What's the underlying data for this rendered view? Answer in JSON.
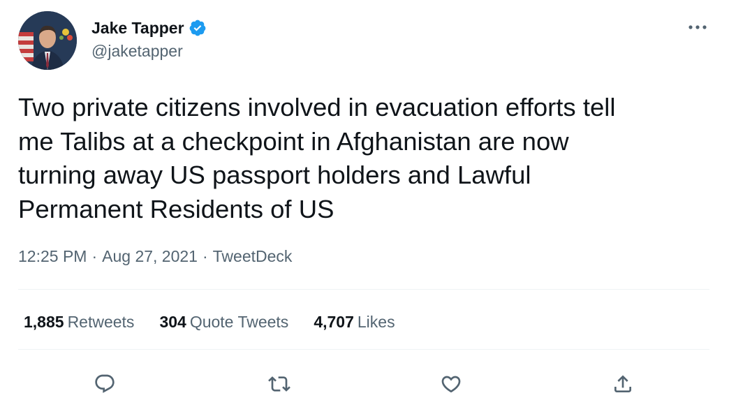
{
  "author": {
    "display_name": "Jake Tapper",
    "handle": "@jaketapper",
    "verified": true,
    "avatar_icon": "profile-photo"
  },
  "tweet": {
    "text": "Two private citizens involved in evacuation efforts tell\nme Talibs at a checkpoint in Afghanistan are now\nturning away US passport holders and Lawful\nPermanent Residents of US",
    "time": "12:25 PM",
    "date": "Aug 27, 2021",
    "source": "TweetDeck",
    "separator": "·"
  },
  "stats": {
    "retweets_count": "1,885",
    "retweets_label": "Retweets",
    "quotes_count": "304",
    "quotes_label": "Quote Tweets",
    "likes_count": "4,707",
    "likes_label": "Likes"
  },
  "actions": [
    "reply-icon",
    "retweet-icon",
    "like-icon",
    "share-icon"
  ],
  "colors": {
    "text_primary": "#0f1419",
    "text_secondary": "#536471",
    "verified_blue": "#1d9bf0",
    "divider": "#eff3f4"
  }
}
